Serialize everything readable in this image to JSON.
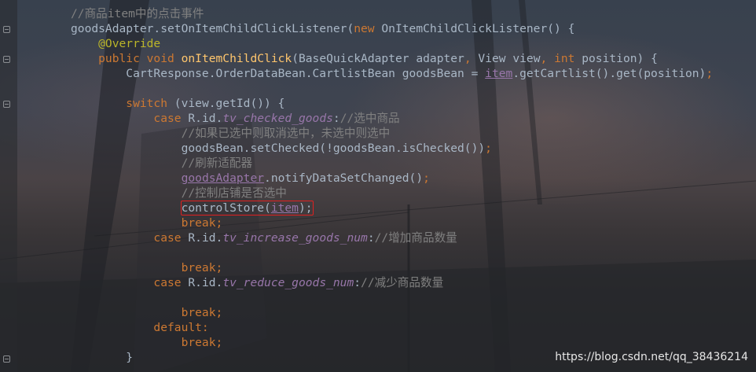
{
  "colors": {
    "keyword": "#cc7832",
    "method": "#ffc66d",
    "annotation": "#bbb529",
    "comment": "#808080",
    "field": "#9876aa",
    "text": "#a9b7c6",
    "highlight_box": "#e02020"
  },
  "lines": [
    {
      "tokens": [
        {
          "t": "//商品item中的点击事件",
          "c": "cm"
        }
      ]
    },
    {
      "tokens": [
        {
          "t": "goodsAdapter.setOnItemChildClickListener(",
          "c": ""
        },
        {
          "t": "new ",
          "c": "kw"
        },
        {
          "t": "OnItemChildClickListener() {",
          "c": ""
        }
      ]
    },
    {
      "tokens": [
        {
          "t": "    @Override",
          "c": "ann"
        }
      ]
    },
    {
      "tokens": [
        {
          "t": "    public void ",
          "c": "kw"
        },
        {
          "t": "onItemChildClick",
          "c": "fn"
        },
        {
          "t": "(BaseQuickAdapter adapter",
          "c": ""
        },
        {
          "t": ", ",
          "c": "kw"
        },
        {
          "t": "View view",
          "c": ""
        },
        {
          "t": ", ",
          "c": "kw"
        },
        {
          "t": "int ",
          "c": "kw"
        },
        {
          "t": "position) {",
          "c": ""
        }
      ]
    },
    {
      "tokens": [
        {
          "t": "        CartResponse.OrderDataBean.CartlistBean goodsBean = ",
          "c": ""
        },
        {
          "t": "item",
          "c": "fld ul"
        },
        {
          "t": ".getCartlist().get(position)",
          "c": ""
        },
        {
          "t": ";",
          "c": "kw"
        }
      ]
    },
    {
      "tokens": [
        {
          "t": "",
          "c": ""
        }
      ]
    },
    {
      "tokens": [
        {
          "t": "        switch ",
          "c": "kw"
        },
        {
          "t": "(view.getId()) {",
          "c": ""
        }
      ]
    },
    {
      "tokens": [
        {
          "t": "            case ",
          "c": "kw"
        },
        {
          "t": "R.id.",
          "c": ""
        },
        {
          "t": "tv_checked_goods",
          "c": "id"
        },
        {
          "t": ":",
          "c": ""
        },
        {
          "t": "//选中商品",
          "c": "cm"
        }
      ]
    },
    {
      "tokens": [
        {
          "t": "                //如果已选中则取消选中，未选中则选中",
          "c": "cm"
        }
      ]
    },
    {
      "tokens": [
        {
          "t": "                goodsBean.setChecked(!goodsBean.isChecked())",
          "c": ""
        },
        {
          "t": ";",
          "c": "kw"
        }
      ]
    },
    {
      "tokens": [
        {
          "t": "                //刷新适配器",
          "c": "cm"
        }
      ]
    },
    {
      "tokens": [
        {
          "t": "                ",
          "c": ""
        },
        {
          "t": "goodsAdapter",
          "c": "fld ul"
        },
        {
          "t": ".notifyDataSetChanged()",
          "c": ""
        },
        {
          "t": ";",
          "c": "kw"
        }
      ]
    },
    {
      "tokens": [
        {
          "t": "                //控制店铺是否选中",
          "c": "cm"
        }
      ]
    },
    {
      "tokens": [
        {
          "t": "                ",
          "c": ""
        },
        {
          "t": "controlStore(",
          "c": "hlstart"
        },
        {
          "t": "item",
          "c": "fld ul"
        },
        {
          "t": ");",
          "c": "hlend"
        }
      ]
    },
    {
      "tokens": [
        {
          "t": "                break;",
          "c": "kw"
        }
      ]
    },
    {
      "tokens": [
        {
          "t": "            case ",
          "c": "kw"
        },
        {
          "t": "R.id.",
          "c": ""
        },
        {
          "t": "tv_increase_goods_num",
          "c": "id"
        },
        {
          "t": ":",
          "c": ""
        },
        {
          "t": "//增加商品数量",
          "c": "cm"
        }
      ]
    },
    {
      "tokens": [
        {
          "t": "",
          "c": ""
        }
      ]
    },
    {
      "tokens": [
        {
          "t": "                break;",
          "c": "kw"
        }
      ]
    },
    {
      "tokens": [
        {
          "t": "            case ",
          "c": "kw"
        },
        {
          "t": "R.id.",
          "c": ""
        },
        {
          "t": "tv_reduce_goods_num",
          "c": "id"
        },
        {
          "t": ":",
          "c": ""
        },
        {
          "t": "//减少商品数量",
          "c": "cm"
        }
      ]
    },
    {
      "tokens": [
        {
          "t": "",
          "c": ""
        }
      ]
    },
    {
      "tokens": [
        {
          "t": "                break;",
          "c": "kw"
        }
      ]
    },
    {
      "tokens": [
        {
          "t": "            default:",
          "c": "kw"
        }
      ]
    },
    {
      "tokens": [
        {
          "t": "                break;",
          "c": "kw"
        }
      ]
    },
    {
      "tokens": [
        {
          "t": "        }",
          "c": ""
        }
      ]
    }
  ],
  "watermark": "https://blog.csdn.net/qq_38436214"
}
